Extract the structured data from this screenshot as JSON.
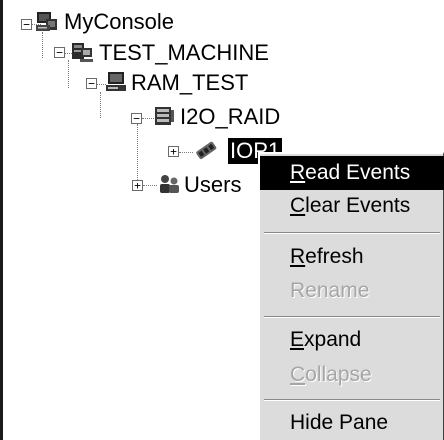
{
  "tree": {
    "nodes": [
      {
        "label": "MyConsole",
        "expander": "−",
        "icon": "console-icon"
      },
      {
        "label": "TEST_MACHINE",
        "expander": "−",
        "icon": "machine-icon"
      },
      {
        "label": "RAM_TEST",
        "expander": "−",
        "icon": "computer-icon"
      },
      {
        "label": "I2O_RAID",
        "expander": "−",
        "icon": "raid-icon"
      },
      {
        "label": "IOP1",
        "expander": "+",
        "icon": "controller-icon",
        "selected": true
      },
      {
        "label": "Users",
        "expander": "+",
        "icon": "users-icon"
      }
    ]
  },
  "context_menu": {
    "items": [
      {
        "first": "R",
        "rest": "ead Events",
        "state": "highlighted"
      },
      {
        "first": "C",
        "rest": "lear Events",
        "state": "enabled"
      },
      {
        "separator": true
      },
      {
        "first": "R",
        "rest": "efresh",
        "state": "enabled"
      },
      {
        "first": "",
        "rest": "Rename",
        "state": "disabled"
      },
      {
        "separator": true
      },
      {
        "first": "E",
        "rest": "xpand",
        "state": "enabled"
      },
      {
        "first": "C",
        "rest": "ollapse",
        "state": "disabled"
      },
      {
        "separator": true
      },
      {
        "first": "",
        "rest": "Hide Pane",
        "state": "enabled"
      }
    ]
  },
  "colors": {
    "selection": "#000000",
    "menu_bg": "#dcdcdc",
    "disabled_text": "#a6a6a6"
  }
}
